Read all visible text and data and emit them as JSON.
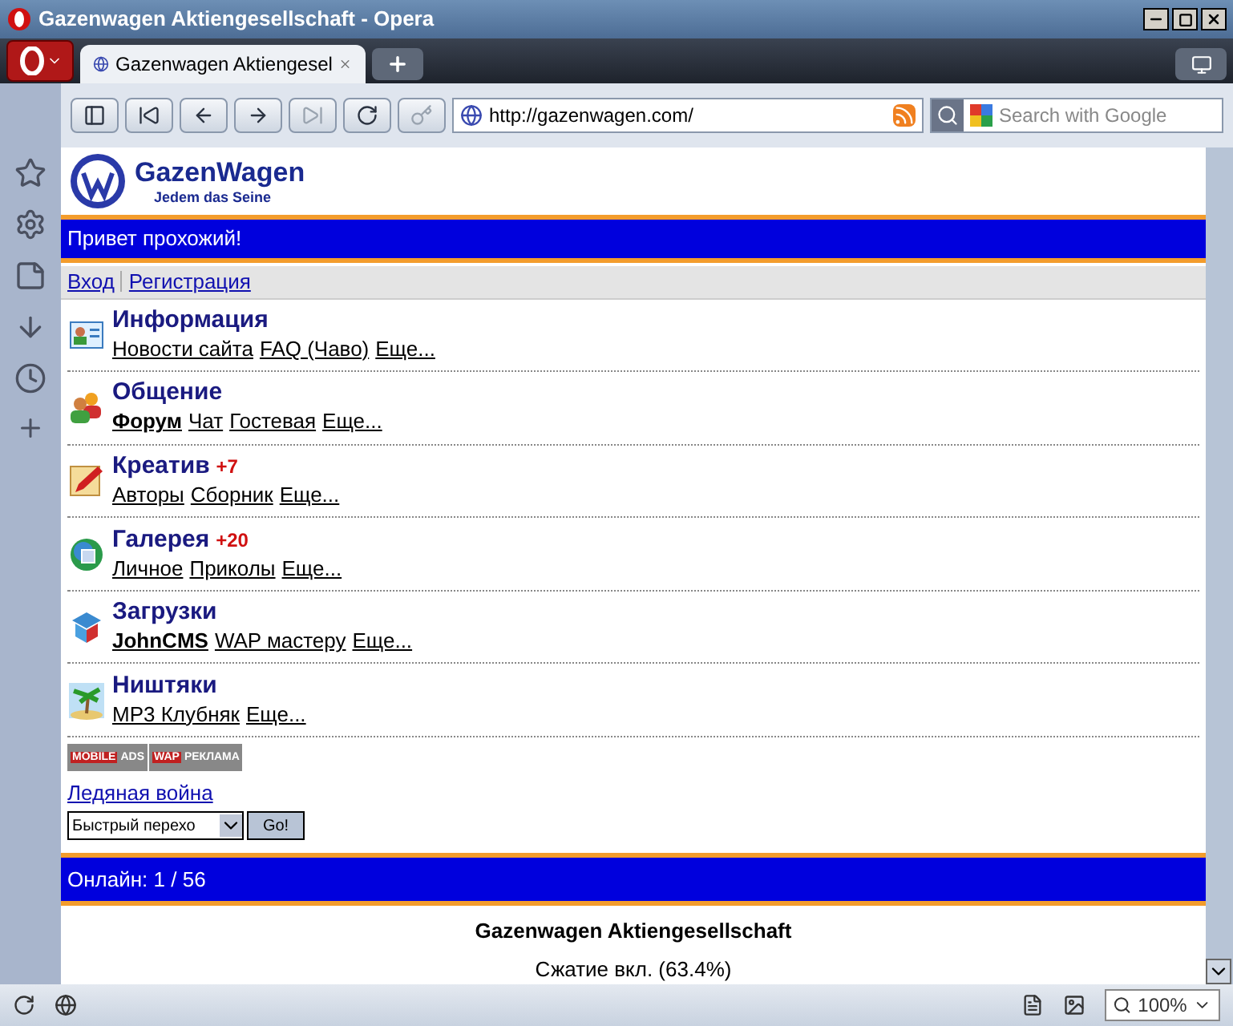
{
  "window": {
    "title": "Gazenwagen Aktiengesellschaft - Opera"
  },
  "tabs": [
    {
      "label": "Gazenwagen Aktiengesel",
      "selected": true
    }
  ],
  "address": {
    "value": "http://gazenwagen.com/"
  },
  "search": {
    "placeholder": "Search with Google"
  },
  "site": {
    "logo": {
      "name": "GazenWagen",
      "slogan": "Jedem das Seine"
    },
    "greeting": "Привет прохожий!",
    "auth_links": [
      "Вход",
      "Регистрация"
    ],
    "sections": [
      {
        "title": "Информация",
        "links": [
          {
            "text": "Новости сайта",
            "bold": false
          },
          {
            "text": "FAQ (Чаво)",
            "bold": false
          },
          {
            "text": "Еще...",
            "bold": false
          }
        ]
      },
      {
        "title": "Общение",
        "links": [
          {
            "text": "Форум",
            "bold": true
          },
          {
            "text": "Чат",
            "bold": false
          },
          {
            "text": "Гостевая",
            "bold": false
          },
          {
            "text": "Еще...",
            "bold": false
          }
        ]
      },
      {
        "title": "Креатив",
        "badge": "+7",
        "links": [
          {
            "text": "Авторы",
            "bold": false
          },
          {
            "text": "Сборник",
            "bold": false
          },
          {
            "text": "Еще...",
            "bold": false
          }
        ]
      },
      {
        "title": "Галерея",
        "badge": "+20",
        "links": [
          {
            "text": "Личное",
            "bold": false
          },
          {
            "text": "Приколы",
            "bold": false
          },
          {
            "text": "Еще...",
            "bold": false
          }
        ]
      },
      {
        "title": "Загрузки",
        "links": [
          {
            "text": "JohnCMS",
            "bold": true
          },
          {
            "text": "WAP мастеру",
            "bold": false
          },
          {
            "text": "Еще...",
            "bold": false
          }
        ]
      },
      {
        "title": "Ништяки",
        "links": [
          {
            "text": "MP3 Клубняк",
            "bold": false
          },
          {
            "text": "Еще...",
            "bold": false
          }
        ]
      }
    ],
    "ads": [
      {
        "line1": "MOBILE",
        "line2": "ADS"
      },
      {
        "line1": "WAP",
        "line2": "РЕКЛАМА"
      }
    ],
    "game_link": "Ледяная война",
    "quick_nav": {
      "value": "Быстрый перехо",
      "button": "Go!"
    },
    "online": "Онлайн: 1 / 56",
    "footer_title": "Gazenwagen Aktiengesellschaft",
    "compression": "Сжатие вкл. (63.4%)"
  },
  "status_bar": {
    "zoom": "100%"
  }
}
